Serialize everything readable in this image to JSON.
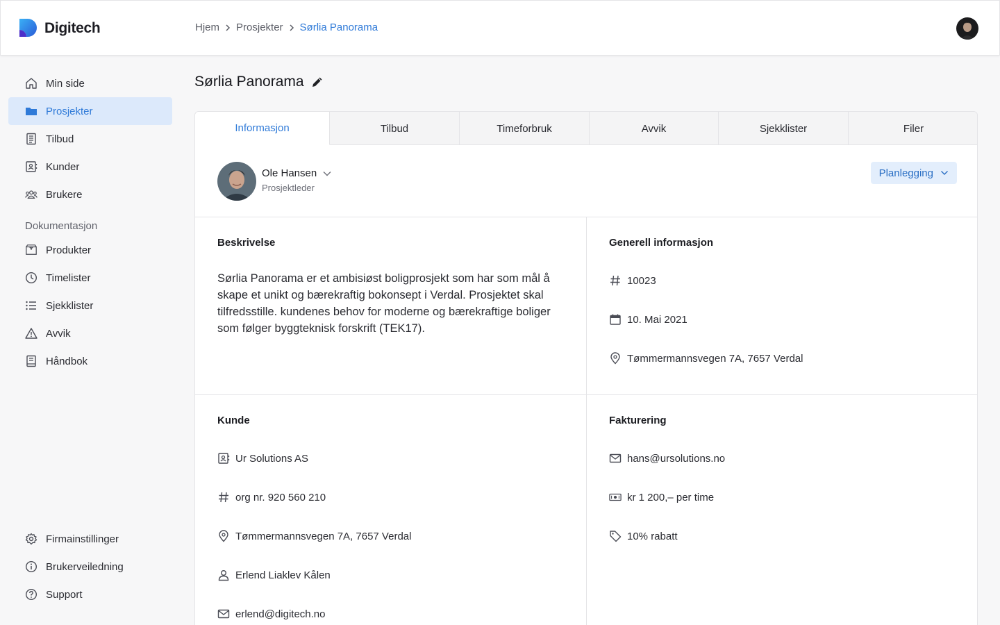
{
  "app": {
    "name": "Digitech"
  },
  "breadcrumb": {
    "items": [
      "Hjem",
      "Prosjekter",
      "Sørlia Panorama"
    ]
  },
  "sidebar": {
    "items": [
      {
        "label": "Min side",
        "icon": "home-icon"
      },
      {
        "label": "Prosjekter",
        "icon": "folder-icon"
      },
      {
        "label": "Tilbud",
        "icon": "receipt-icon"
      },
      {
        "label": "Kunder",
        "icon": "contact-card-icon"
      },
      {
        "label": "Brukere",
        "icon": "users-icon"
      }
    ],
    "section_label": "Dokumentasjon",
    "doc_items": [
      {
        "label": "Produkter",
        "icon": "box-icon"
      },
      {
        "label": "Timelister",
        "icon": "clock-icon"
      },
      {
        "label": "Sjekklister",
        "icon": "list-icon"
      },
      {
        "label": "Avvik",
        "icon": "warning-icon"
      },
      {
        "label": "Håndbok",
        "icon": "book-icon"
      }
    ],
    "bottom_items": [
      {
        "label": "Firmainstillinger",
        "icon": "gear-icon"
      },
      {
        "label": "Brukerveiledning",
        "icon": "info-icon"
      },
      {
        "label": "Support",
        "icon": "help-icon"
      }
    ]
  },
  "page": {
    "title": "Sørlia Panorama"
  },
  "tabs": [
    "Informasjon",
    "Tilbud",
    "Timeforbruk",
    "Avvik",
    "Sjekklister",
    "Filer"
  ],
  "project_manager": {
    "name": "Ole Hansen",
    "role": "Prosjektleder"
  },
  "status": {
    "label": "Planlegging"
  },
  "description": {
    "title": "Beskrivelse",
    "text": "Sørlia Panorama er et ambisiøst boligprosjekt som har som mål å skape et unikt og bærekraftig bokonsept i Verdal. Prosjektet skal tilfredsstille. kundenes behov for moderne og bærekraftige boliger som følger byggteknisk forskrift (TEK17)."
  },
  "general": {
    "title": "Generell informasjon",
    "number": "10023",
    "date": "10. Mai 2021",
    "address": "Tømmermannsvegen 7A, 7657 Verdal"
  },
  "customer": {
    "title": "Kunde",
    "name": "Ur Solutions AS",
    "org": "org nr. 920 560 210",
    "address": "Tømmermannsvegen 7A, 7657 Verdal",
    "contact": "Erlend Liaklev Kålen",
    "email": "erlend@digitech.no"
  },
  "billing": {
    "title": "Fakturering",
    "email": "hans@ursolutions.no",
    "rate": "kr 1 200,– per time",
    "discount": "10% rabatt"
  },
  "colors": {
    "accent": "#2f7ad8",
    "active_bg": "#dce9fb",
    "status_bg": "#e3eefc"
  }
}
